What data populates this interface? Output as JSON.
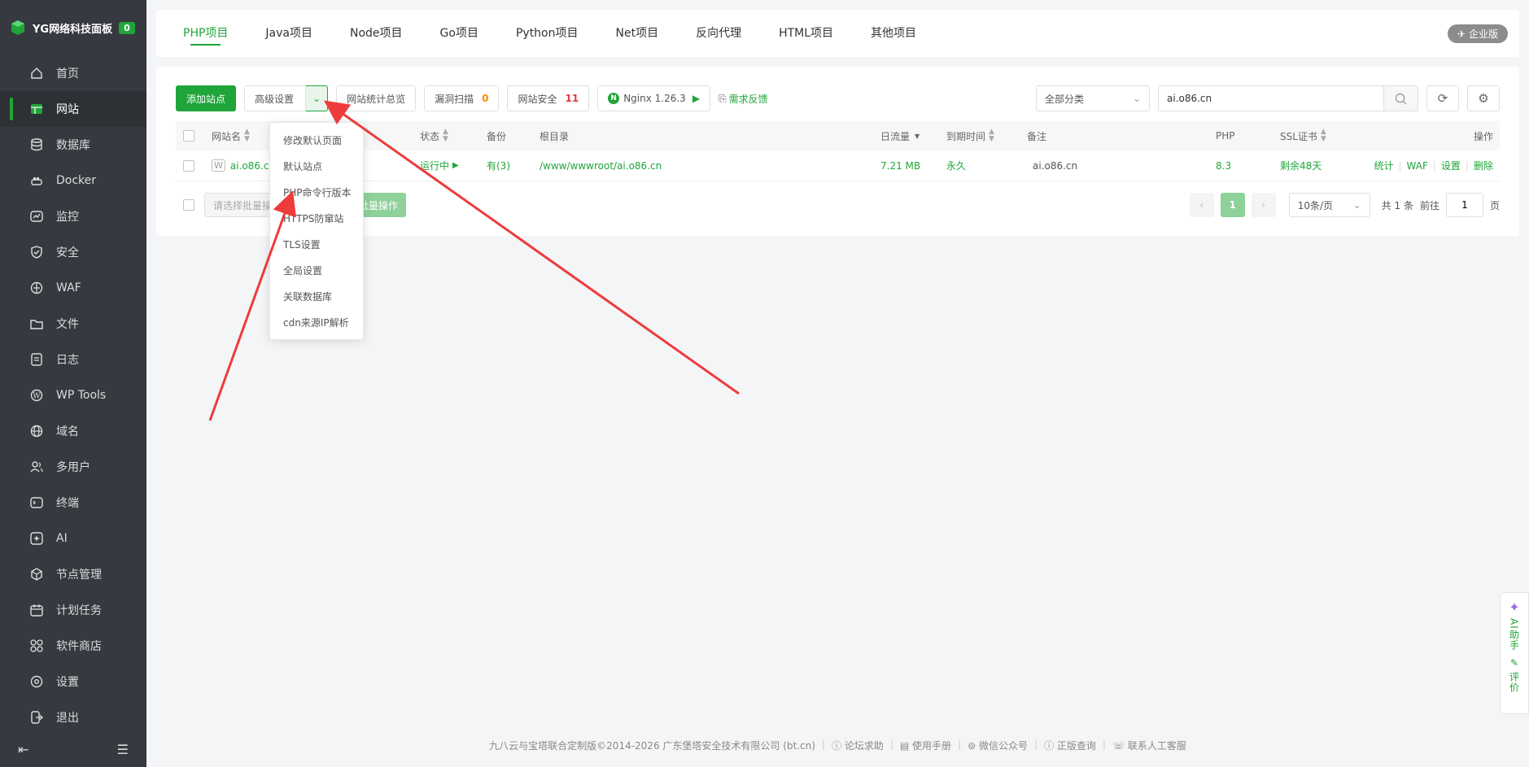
{
  "brand": {
    "title": "YG网络科技面板",
    "badge": "0"
  },
  "nav": [
    {
      "label": "首页",
      "icon": "home-icon"
    },
    {
      "label": "网站",
      "icon": "website-icon",
      "active": true
    },
    {
      "label": "数据库",
      "icon": "database-icon"
    },
    {
      "label": "Docker",
      "icon": "docker-icon"
    },
    {
      "label": "监控",
      "icon": "monitor-icon"
    },
    {
      "label": "安全",
      "icon": "shield-icon"
    },
    {
      "label": "WAF",
      "icon": "waf-icon"
    },
    {
      "label": "文件",
      "icon": "folder-icon"
    },
    {
      "label": "日志",
      "icon": "log-icon"
    },
    {
      "label": "WP Tools",
      "icon": "wordpress-icon"
    },
    {
      "label": "域名",
      "icon": "globe-icon"
    },
    {
      "label": "多用户",
      "icon": "users-icon"
    },
    {
      "label": "终端",
      "icon": "terminal-icon"
    },
    {
      "label": "AI",
      "icon": "ai-icon"
    },
    {
      "label": "节点管理",
      "icon": "node-icon"
    },
    {
      "label": "计划任务",
      "icon": "calendar-icon"
    },
    {
      "label": "软件商店",
      "icon": "store-icon"
    },
    {
      "label": "设置",
      "icon": "gear-icon"
    },
    {
      "label": "退出",
      "icon": "logout-icon"
    }
  ],
  "tabs": [
    "PHP项目",
    "Java项目",
    "Node项目",
    "Go项目",
    "Python项目",
    "Net项目",
    "反向代理",
    "HTML项目",
    "其他项目"
  ],
  "enterprise_label": "企业版",
  "toolbar": {
    "add_site": "添加站点",
    "advanced": "高级设置",
    "stats": "网站统计总览",
    "vuln_scan": "漏洞扫描",
    "vuln_count": "0",
    "security": "网站安全",
    "security_count": "11",
    "nginx": "Nginx 1.26.3",
    "feedback": "需求反馈",
    "category": "全部分类",
    "search_value": "ai.o86.cn"
  },
  "table": {
    "headers": {
      "name": "网站名",
      "status": "状态",
      "backup": "备份",
      "root": "根目录",
      "traffic": "日流量",
      "expire": "到期时间",
      "remark": "备注",
      "php": "PHP",
      "ssl": "SSL证书",
      "ops": "操作"
    },
    "rows": [
      {
        "name": "ai.o86.cn",
        "status": "运行中",
        "backup": "有(3)",
        "root": "/www/wwwroot/ai.o86.cn",
        "traffic": "7.21 MB",
        "expire": "永久",
        "remark": "ai.o86.cn",
        "php": "8.3",
        "ssl": "剩余48天",
        "ops": [
          "统计",
          "WAF",
          "设置",
          "删除"
        ]
      }
    ]
  },
  "batch": {
    "placeholder": "请选择批量操作",
    "button": "批量操作"
  },
  "pager": {
    "current": "1",
    "size": "10条/页",
    "total": "共 1 条",
    "goto": "前往",
    "page_value": "1",
    "page_unit": "页"
  },
  "dropdown": [
    "修改默认页面",
    "默认站点",
    "PHP命令行版本",
    "HTTPS防窜站",
    "TLS设置",
    "全局设置",
    "关联数据库",
    "cdn来源IP解析"
  ],
  "helper": {
    "ai": "AI助手",
    "rate": "评价"
  },
  "footer": {
    "copyright": "九八云与宝塔联合定制版©2014-2026 广东堡塔安全技术有限公司 (bt.cn)",
    "links": [
      "论坛求助",
      "使用手册",
      "微信公众号",
      "正版查询",
      "联系人工客服"
    ]
  },
  "colors": {
    "accent": "#20a53a",
    "sidebar": "#36393f",
    "danger": "#e4393c",
    "warn": "#ff8c00",
    "annotation": "#ee3b3b"
  }
}
